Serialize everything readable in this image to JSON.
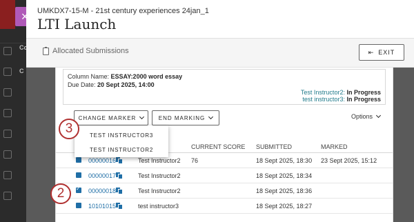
{
  "window": {
    "breadcrumb": "UMKDX7-15-M - 21st century experiences 24jan_1",
    "title": "LTI Launch",
    "close_icon": "close-icon"
  },
  "subbar": {
    "title": "Allocated Submissions",
    "exit_label": "EXIT"
  },
  "info": {
    "column_name_label": "Column Name:",
    "column_name_value": "ESSAY:2000 word essay",
    "due_date_label": "Due Date:",
    "due_date_value": "20 Sept 2025, 14:00",
    "statuses": [
      {
        "name": "Test Instructor2:",
        "status": "In Progress"
      },
      {
        "name": "test instructor3:",
        "status": "In Progress"
      }
    ]
  },
  "toolbar": {
    "change_marker_label": "CHANGE MARKER",
    "end_marking_label": "END MARKING",
    "options_label": "Options"
  },
  "dropdown": {
    "items": [
      "TEST INSTRUCTOR3",
      "TEST INSTRUCTOR2"
    ]
  },
  "callouts": [
    "3",
    "2"
  ],
  "table": {
    "headers": [
      "CURRENT SCORE",
      "SUBMITTED",
      "MARKED"
    ],
    "rows": [
      {
        "id": "00000016",
        "marker": "Test Instructor2",
        "score": "76",
        "submitted": "18 Sept 2025, 18:30",
        "marked": "23 Sept 2025, 15:12",
        "checked": false
      },
      {
        "id": "00000017",
        "marker": "Test Instructor2",
        "score": "",
        "submitted": "18 Sept 2025, 18:34",
        "marked": "",
        "checked": false
      },
      {
        "id": "00000018",
        "marker": "Test Instructor2",
        "score": "",
        "submitted": "18 Sept 2025, 18:36",
        "marked": "",
        "checked": true
      },
      {
        "id": "10101015",
        "marker": "test instructor3",
        "score": "",
        "submitted": "18 Sept 2025, 18:27",
        "marked": "",
        "checked": false
      }
    ]
  },
  "background": {
    "nav_labels": [
      "Co",
      "C"
    ]
  }
}
